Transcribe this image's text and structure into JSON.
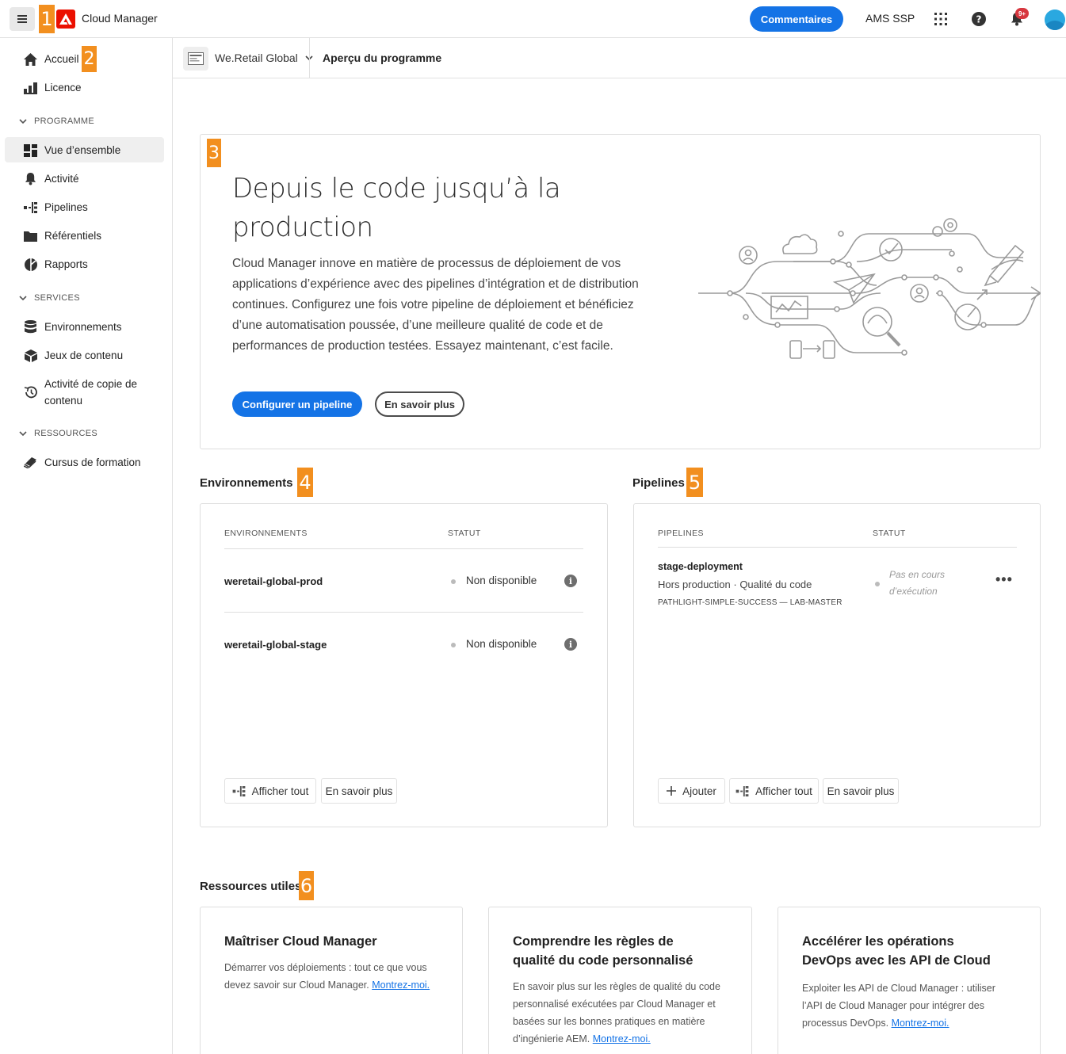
{
  "header": {
    "app_name": "Cloud Manager",
    "feedback_label": "Commentaires",
    "org_name": "AMS SSP",
    "notification_count": "9+",
    "callout_menu": "1"
  },
  "sidebar": {
    "home_label": "Accueil",
    "callout_home": "2",
    "licence_label": "Licence",
    "section_programme": "PROGRAMME",
    "overview_label": "Vue d’ensemble",
    "activity_label": "Activité",
    "pipelines_label": "Pipelines",
    "repos_label": "Référentiels",
    "reports_label": "Rapports",
    "section_services": "SERVICES",
    "environments_label": "Environnements",
    "content_sets_label": "Jeux de contenu",
    "content_copy_label_1": "Activité de copie de",
    "content_copy_label_2": "contenu",
    "section_resources": "RESSOURCES",
    "learning_label": "Cursus de formation"
  },
  "subheader": {
    "program_name": "We.Retail Global",
    "page_title": "Aperçu du programme"
  },
  "hero": {
    "callout": "3",
    "title": "Depuis le code jusqu’à la production",
    "body": "Cloud Manager innove en matière de processus de déploiement de vos applications d’expérience avec des pipelines d’intégration et de distribution continues. Configurez une fois votre pipeline de déploiement et bénéficiez d’une automatisation poussée, d’une meilleure qualité de code et de performances de production testées. Essayez maintenant, c’est facile.",
    "primary_button": "Configurer un pipeline",
    "secondary_button": "En savoir plus"
  },
  "environments": {
    "title": "Environnements",
    "callout": "4",
    "col_name": "ENVIRONNEMENTS",
    "col_status": "STATUT",
    "rows": [
      {
        "name": "weretail-global-prod",
        "status": "Non disponible"
      },
      {
        "name": "weretail-global-stage",
        "status": "Non disponible"
      }
    ],
    "view_all": "Afficher tout",
    "learn_more": "En savoir plus"
  },
  "pipelines": {
    "title": "Pipelines",
    "callout": "5",
    "col_name": "PIPELINES",
    "col_status": "STATUT",
    "rows": [
      {
        "name": "stage-deployment",
        "meta": "Hors production  ·  Qualité du code",
        "branch": "PATHLIGHT-SIMPLE-SUCCESS — LAB-MASTER",
        "status_1": "Pas en cours",
        "status_2": "d’exécution"
      }
    ],
    "add": "Ajouter",
    "view_all": "Afficher tout",
    "learn_more": "En savoir plus"
  },
  "resources": {
    "title": "Ressources utiles",
    "callout": "6",
    "link_label": "Montrez-moi.",
    "cards": [
      {
        "title_1": "Maîtriser Cloud Manager",
        "title_2": "",
        "body_1": "Démarrer vos déploiements : tout ce que vous",
        "body_2": "devez savoir sur Cloud Manager.",
        "body_3": "",
        "body_4": ""
      },
      {
        "title_1": "Comprendre les règles de",
        "title_2": "qualité du code personnalisé",
        "body_1": "En savoir plus sur les règles de qualité du code",
        "body_2": "personnalisé exécutées par Cloud Manager et",
        "body_3": "basées sur les bonnes pratiques en matière",
        "body_4": "d’ingénierie AEM."
      },
      {
        "title_1": "Accélérer les opérations",
        "title_2": "DevOps avec les API de Cloud",
        "body_1": "Exploiter les API de Cloud Manager : utiliser",
        "body_2": "l’API de Cloud Manager pour intégrer des",
        "body_3": "processus DevOps.",
        "body_4": ""
      }
    ]
  },
  "colors": {
    "accent": "#1473e6",
    "callout": "#f28f1f",
    "adobe_red": "#eb1000"
  },
  "icons": [
    "menu-icon",
    "adobe-logo",
    "apps-grid-icon",
    "help-icon",
    "bell-icon",
    "home-icon",
    "licence-icon",
    "overview-icon",
    "bell-activity-icon",
    "pipeline-icon",
    "folder-icon",
    "reports-icon",
    "database-icon",
    "package-icon",
    "history-icon",
    "learning-icon",
    "info-icon",
    "plus-icon",
    "chevron-down-icon"
  ]
}
